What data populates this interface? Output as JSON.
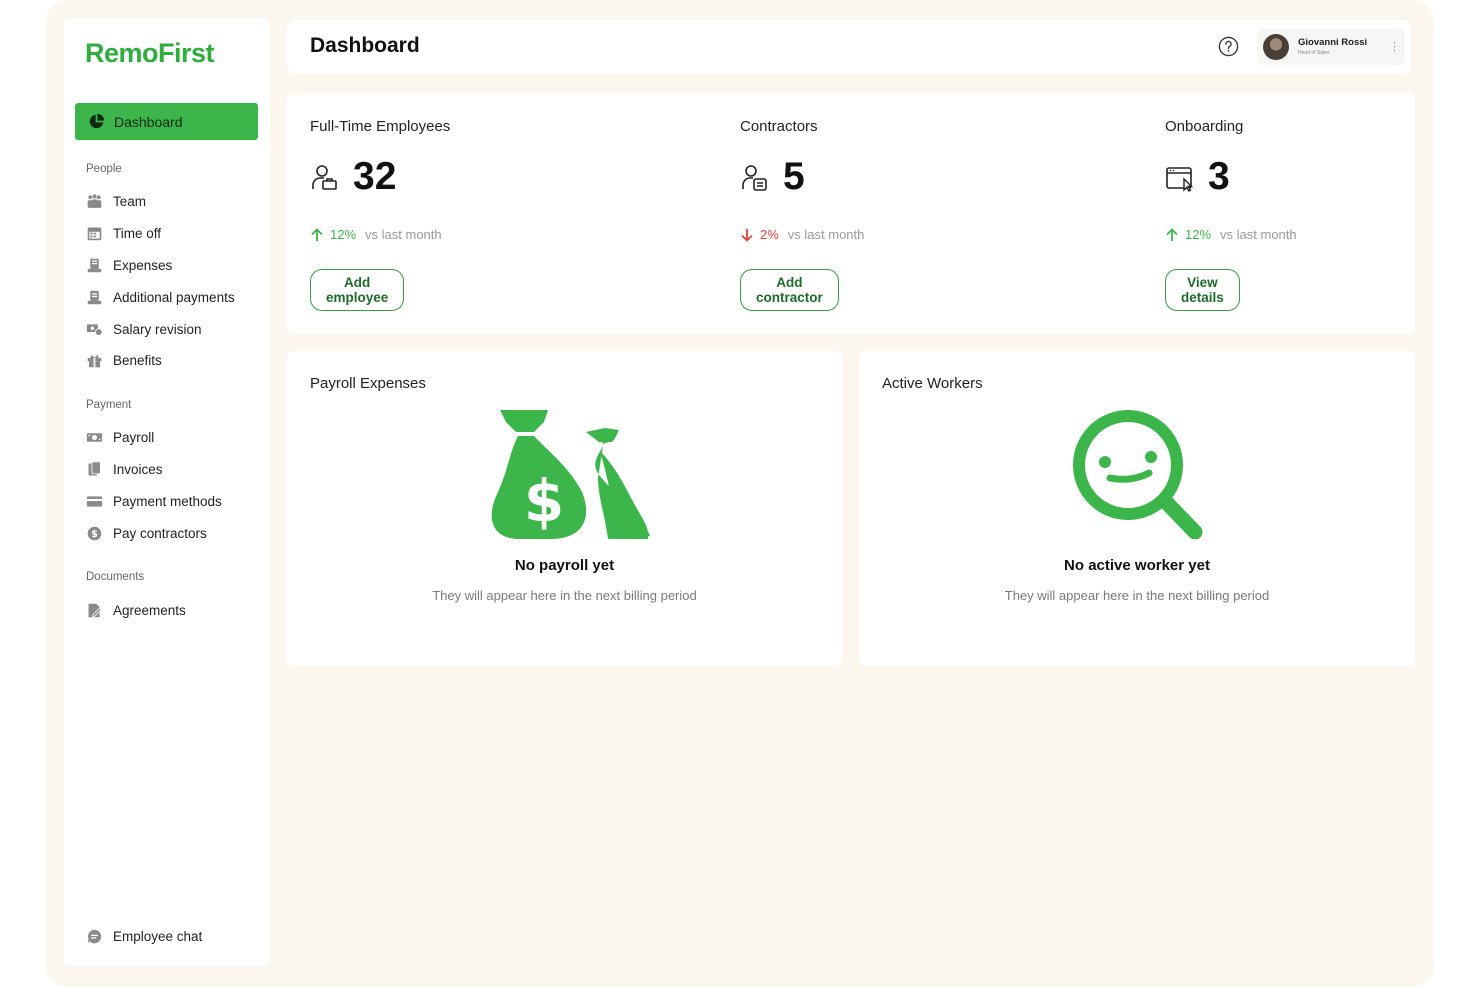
{
  "brand": {
    "name": "RemoFirst",
    "accent": "#3cb54a"
  },
  "sidebar": {
    "active": {
      "label": "Dashboard",
      "icon": "pie-chart-icon"
    },
    "sections": [
      {
        "title": "People",
        "items": [
          {
            "label": "Team",
            "icon": "team-icon"
          },
          {
            "label": "Time off",
            "icon": "calendar-icon"
          },
          {
            "label": "Expenses",
            "icon": "expenses-icon"
          },
          {
            "label": "Additional payments",
            "icon": "additional-payments-icon"
          },
          {
            "label": "Salary revision",
            "icon": "salary-revision-icon"
          },
          {
            "label": "Benefits",
            "icon": "gift-icon"
          }
        ]
      },
      {
        "title": "Payment",
        "items": [
          {
            "label": "Payroll",
            "icon": "cash-icon"
          },
          {
            "label": "Invoices",
            "icon": "invoice-icon"
          },
          {
            "label": "Payment methods",
            "icon": "credit-card-icon"
          },
          {
            "label": "Pay contractors",
            "icon": "dollar-coin-icon"
          }
        ]
      },
      {
        "title": "Documents",
        "items": [
          {
            "label": "Agreements",
            "icon": "agreement-icon"
          }
        ]
      }
    ],
    "footer": {
      "label": "Employee chat",
      "icon": "chat-icon"
    }
  },
  "header": {
    "title": "Dashboard",
    "help_icon": "help-icon",
    "user": {
      "name": "Giovanni Rossi",
      "role": "Head of Sales"
    }
  },
  "stats": [
    {
      "label": "Full-Time Employees",
      "value": "32",
      "trend": "12%",
      "direction": "up",
      "compare": "vs last month",
      "button": "Add employee",
      "icon": "employee-icon"
    },
    {
      "label": "Contractors",
      "value": "5",
      "trend": "2%",
      "direction": "down",
      "compare": "vs last month",
      "button": "Add contractor",
      "icon": "contractor-icon"
    },
    {
      "label": "Onboarding",
      "value": "3",
      "trend": "12%",
      "direction": "up",
      "compare": "vs last month",
      "button": "View details",
      "icon": "onboarding-window-icon"
    }
  ],
  "panels": {
    "payroll": {
      "title": "Payroll Expenses",
      "empty_title": "No payroll yet",
      "empty_sub": "They will appear here in the next billing period",
      "illustration": "money-bags-icon"
    },
    "workers": {
      "title": "Active Workers",
      "empty_title": "No active worker yet",
      "empty_sub": "They will appear here in the next billing period",
      "illustration": "smiley-magnifier-icon"
    }
  }
}
